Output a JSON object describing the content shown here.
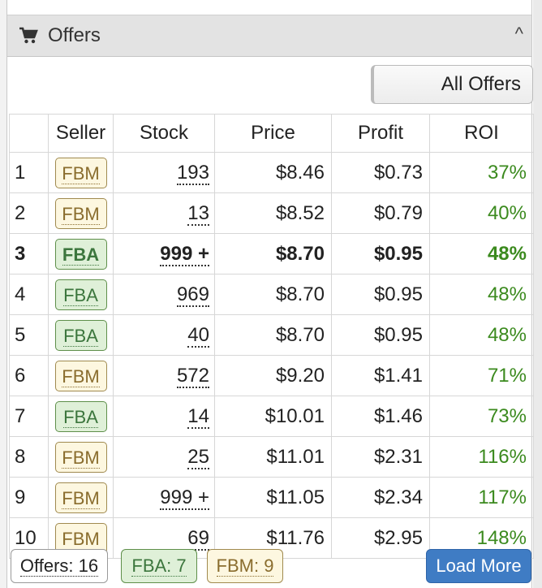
{
  "panel": {
    "title": "Offers",
    "header_icon": "cart-icon",
    "collapse_icon": "chevron-up-icon",
    "collapse_glyph": "^",
    "all_offers_label": "All Offers"
  },
  "table": {
    "headers": {
      "seller": "Seller",
      "stock": "Stock",
      "price": "Price",
      "profit": "Profit",
      "roi": "ROI"
    },
    "rows": [
      {
        "num": "1",
        "seller": "FBM",
        "stock": "193",
        "price": "$8.46",
        "profit": "$0.73",
        "roi": "37%"
      },
      {
        "num": "2",
        "seller": "FBM",
        "stock": "13",
        "price": "$8.52",
        "profit": "$0.79",
        "roi": "40%"
      },
      {
        "num": "3",
        "seller": "FBA",
        "stock": "999 +",
        "price": "$8.70",
        "profit": "$0.95",
        "roi": "48%"
      },
      {
        "num": "4",
        "seller": "FBA",
        "stock": "969",
        "price": "$8.70",
        "profit": "$0.95",
        "roi": "48%"
      },
      {
        "num": "5",
        "seller": "FBA",
        "stock": "40",
        "price": "$8.70",
        "profit": "$0.95",
        "roi": "48%"
      },
      {
        "num": "6",
        "seller": "FBM",
        "stock": "572",
        "price": "$9.20",
        "profit": "$1.41",
        "roi": "71%"
      },
      {
        "num": "7",
        "seller": "FBA",
        "stock": "14",
        "price": "$10.01",
        "profit": "$1.46",
        "roi": "73%"
      },
      {
        "num": "8",
        "seller": "FBM",
        "stock": "25",
        "price": "$11.01",
        "profit": "$2.31",
        "roi": "116%"
      },
      {
        "num": "9",
        "seller": "FBM",
        "stock": "999 +",
        "price": "$11.05",
        "profit": "$2.34",
        "roi": "117%"
      },
      {
        "num": "10",
        "seller": "FBM",
        "stock": "69",
        "price": "$11.76",
        "profit": "$2.95",
        "roi": "148%"
      }
    ]
  },
  "footer": {
    "offers_count": "Offers: 16",
    "fba_count": "FBA: 7",
    "fbm_count": "FBM: 9",
    "load_more_label": "Load More"
  },
  "colors": {
    "fba_bg": "#dff0d8",
    "fbm_bg": "#fdf7e0",
    "roi_green": "#3b8a1e",
    "load_more_blue": "#3f7cc4"
  }
}
